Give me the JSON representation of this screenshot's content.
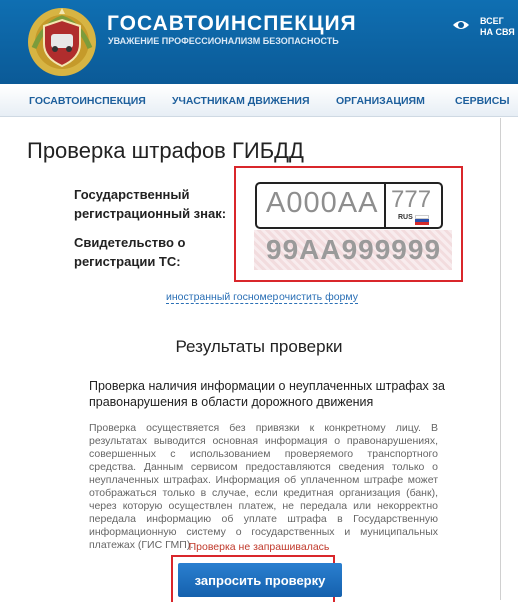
{
  "header": {
    "title": "ГОСАВТОИНСПЕКЦИЯ",
    "subtitle": "УВАЖЕНИЕ ПРОФЕССИОНАЛИЗМ БЕЗОПАСНОСТЬ",
    "right_line1": "ВСЕГ",
    "right_line2": "НА СВЯ"
  },
  "nav": {
    "items": [
      {
        "label": "ГОСАВТОИНСПЕКЦИЯ"
      },
      {
        "label": "УЧАСТНИКАМ ДВИЖЕНИЯ"
      },
      {
        "label": "ОРГАНИЗАЦИЯМ"
      },
      {
        "label": "СЕРВИСЫ"
      }
    ]
  },
  "page": {
    "title": "Проверка штрафов ГИБДД"
  },
  "form": {
    "plate_label_line1": "Государственный",
    "plate_label_line2": "регистрационный знак:",
    "plate_placeholder": "А000АА",
    "region_placeholder": "777",
    "plate_country": "RUS",
    "cert_label_line1": "Свидетельство о",
    "cert_label_line2": "регистрации ТС:",
    "cert_placeholder": "99АА999999",
    "foreign_link": "иностранный госномер",
    "clear_link": "очистить форму"
  },
  "results": {
    "title": "Результаты проверки",
    "check_title": "Проверка наличия информации о неуплаченных штрафах за правонарушения в области дорожного движения",
    "description": "Проверка осуществяется без привязки к конкретному лицу. В результатах выводится основная информация о правонарушениях, совершенных с использованием проверяемого транспортного средства. Данным сервисом предоставляются сведения только о неуплаченных штрафах. Информация об уплаченном штрафе может отображаться только в случае, если кредитная организация (банк), через которую осуществлен платеж, не передала или некорректно передала информацию об уплате штрафа в Государственную информационную систему о государственных и муниципальных платежах (ГИС ГМП).",
    "status": "Проверка не запрашивалась",
    "button_label": "запросить проверку"
  },
  "colors": {
    "header_blue": "#0f6fb2",
    "nav_text": "#1d5f9c",
    "highlight_red": "#d9262b",
    "button_blue": "#1f6fc0"
  }
}
